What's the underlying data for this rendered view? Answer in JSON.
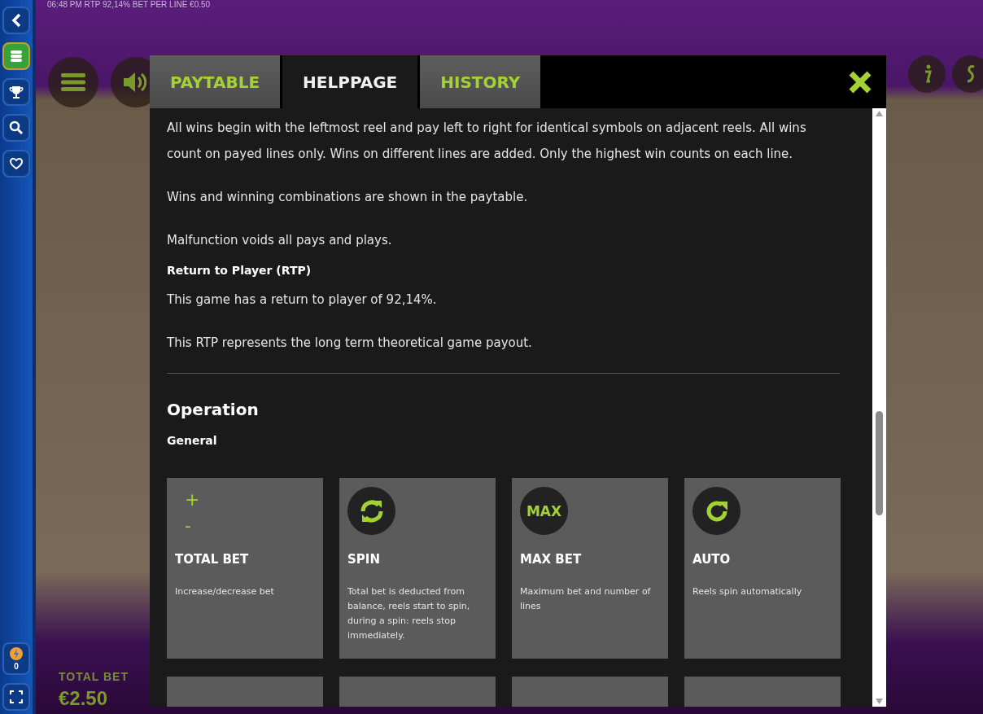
{
  "status_bar": {
    "time": "06:48 PM",
    "rtp": "RTP 92,14%",
    "bet_per_line": "BET PER LINE €0.50"
  },
  "sidebar": {
    "coin_count": "0"
  },
  "hud": {
    "total_bet_label": "TOTAL BET",
    "total_bet_value": "€2.50"
  },
  "modal": {
    "tabs": [
      {
        "label": "PAYTABLE",
        "selected": false
      },
      {
        "label": "HELPPAGE",
        "selected": true
      },
      {
        "label": "HISTORY",
        "selected": false
      }
    ],
    "blocks": [
      {
        "kind": "text",
        "text": "All wins begin with the leftmost reel and pay left to right for identical symbols on adjacent reels. All wins count on payed lines only. Wins on different lines are added. Only the highest win counts on each line."
      },
      {
        "kind": "text",
        "text": "Wins and winning combinations are shown in the paytable."
      },
      {
        "kind": "text",
        "text": "Malfunction voids all pays and plays."
      },
      {
        "kind": "heading",
        "text": "Return to Player (RTP)"
      },
      {
        "kind": "text",
        "text": "This game has a return to player of 92,14%."
      },
      {
        "kind": "text",
        "text": "This RTP represents the long term theoretical game payout."
      }
    ],
    "section_title": "Operation",
    "subsection": "General",
    "cards": [
      {
        "kind": "plusminus",
        "plus": "+",
        "minus": "-",
        "title": "TOTAL BET",
        "description": "Increase/decrease bet"
      },
      {
        "kind": "spin",
        "title": "SPIN",
        "description": "Total bet is deducted from balance, reels start to spin, during a spin: reels stop immediately."
      },
      {
        "kind": "max",
        "icon_text": "MAX",
        "title": "MAX BET",
        "description": "Maximum bet and number of lines"
      },
      {
        "kind": "auto",
        "title": "AUTO",
        "description": "Reels spin automatically"
      }
    ]
  }
}
